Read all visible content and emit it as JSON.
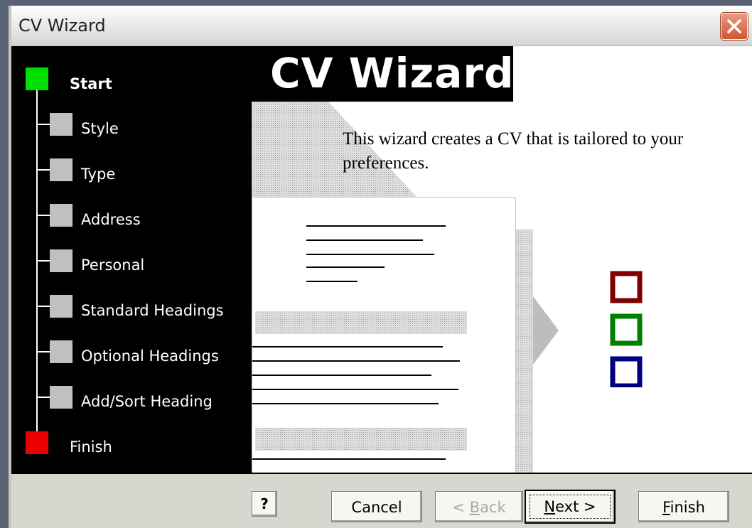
{
  "window": {
    "title": "CV Wizard"
  },
  "steps": [
    {
      "label": "Start",
      "status": "current",
      "color": "#00e000"
    },
    {
      "label": "Style",
      "status": "pending",
      "color": "#c0c0c0"
    },
    {
      "label": "Type",
      "status": "pending",
      "color": "#c0c0c0"
    },
    {
      "label": "Address",
      "status": "pending",
      "color": "#c0c0c0"
    },
    {
      "label": "Personal",
      "status": "pending",
      "color": "#c0c0c0"
    },
    {
      "label": "Standard Headings",
      "status": "pending",
      "color": "#c0c0c0"
    },
    {
      "label": "Optional Headings",
      "status": "pending",
      "color": "#c0c0c0"
    },
    {
      "label": "Add/Sort Heading",
      "status": "pending",
      "color": "#c0c0c0"
    },
    {
      "label": "Finish",
      "status": "end",
      "color": "#ee0000"
    }
  ],
  "main": {
    "banner": "CV Wizard",
    "description": "This wizard creates a CV that is tailored to your preferences.",
    "checkbox_colors": [
      "#800000",
      "#008000",
      "#000080"
    ]
  },
  "buttons": {
    "help": "?",
    "cancel": "Cancel",
    "back_prefix": "< ",
    "back_key": "B",
    "back_rest": "ack",
    "next_key": "N",
    "next_rest": "ext >",
    "finish_key": "F",
    "finish_rest": "inish"
  }
}
